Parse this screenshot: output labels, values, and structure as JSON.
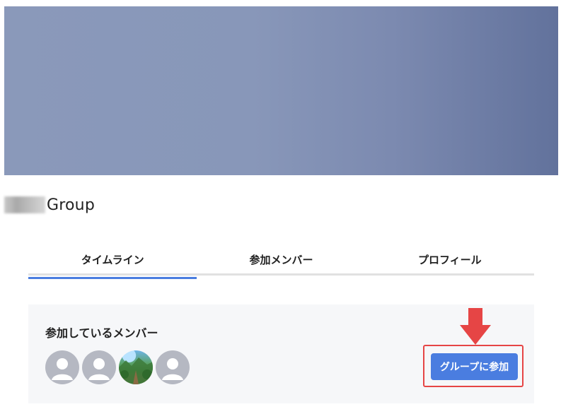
{
  "group": {
    "name_suffix": "Group"
  },
  "tabs": [
    {
      "label": "タイムライン",
      "active": true
    },
    {
      "label": "参加メンバー",
      "active": false
    },
    {
      "label": "プロフィール",
      "active": false
    }
  ],
  "members_panel": {
    "heading": "参加しているメンバー",
    "avatars": [
      {
        "type": "default-user-icon"
      },
      {
        "type": "default-user-icon"
      },
      {
        "type": "photo"
      },
      {
        "type": "default-user-icon"
      }
    ],
    "join_button_label": "グループに参加"
  },
  "colors": {
    "accent": "#4a7de0",
    "highlight": "#e64545",
    "avatar_gray": "#b5b8c2",
    "panel_bg": "#f6f7f9"
  }
}
